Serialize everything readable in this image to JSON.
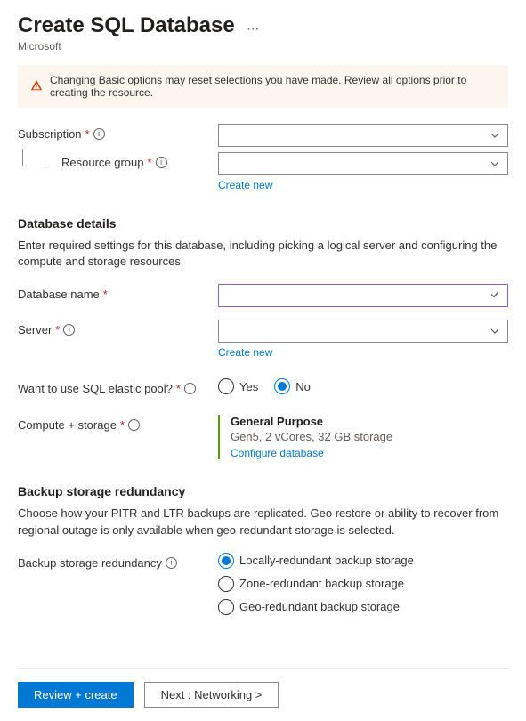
{
  "header": {
    "title": "Create SQL Database",
    "subtitle": "Microsoft"
  },
  "warning": {
    "text": "Changing Basic options may reset selections you have made. Review all options prior to creating the resource."
  },
  "fields": {
    "subscription_label": "Subscription",
    "resource_group_label": "Resource group",
    "create_new": "Create new"
  },
  "database_details": {
    "heading": "Database details",
    "description": "Enter required settings for this database, including picking a logical server and configuring the compute and storage resources",
    "db_name_label": "Database name",
    "server_label": "Server",
    "elastic_label": "Want to use SQL elastic pool?",
    "elastic_yes": "Yes",
    "elastic_no": "No",
    "compute_label": "Compute + storage",
    "compute_title": "General Purpose",
    "compute_sub": "Gen5, 2 vCores, 32 GB storage",
    "configure_db": "Configure database"
  },
  "backup": {
    "heading": "Backup storage redundancy",
    "description": "Choose how your PITR and LTR backups are replicated. Geo restore or ability to recover from regional outage is only available when geo-redundant storage is selected.",
    "label": "Backup storage redundancy",
    "options": {
      "local": "Locally-redundant backup storage",
      "zone": "Zone-redundant backup storage",
      "geo": "Geo-redundant backup storage"
    }
  },
  "footer": {
    "review": "Review + create",
    "next": "Next : Networking >"
  }
}
